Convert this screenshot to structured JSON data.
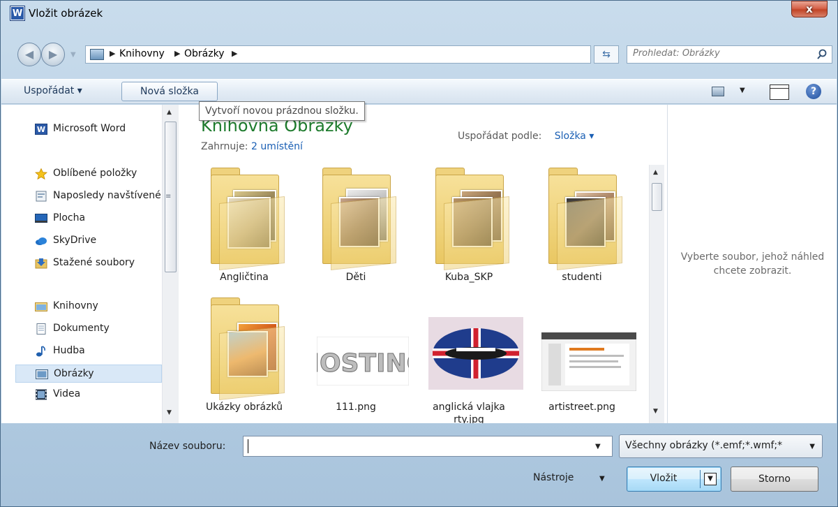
{
  "window": {
    "title": "Vložit obrázek",
    "app_icon_letter": "W",
    "close_label": "x"
  },
  "address": {
    "path": [
      "Knihovny",
      "Obrázky"
    ],
    "search_placeholder": "Prohledat: Obrázky"
  },
  "toolbar": {
    "organize_label": "Uspořádat ▾",
    "new_folder_label": "Nová složka",
    "tooltip": "Vytvoří novou prázdnou složku."
  },
  "nav_pane": {
    "items": [
      {
        "label": "Microsoft Word",
        "icon": "word-icon"
      },
      {
        "label": "Oblíbené položky",
        "icon": "star-icon"
      },
      {
        "label": "Naposledy navštívené",
        "icon": "recent-places-icon"
      },
      {
        "label": "Plocha",
        "icon": "desktop-icon"
      },
      {
        "label": "SkyDrive",
        "icon": "skydrive-icon"
      },
      {
        "label": "Stažené soubory",
        "icon": "downloads-icon"
      },
      {
        "label": "Knihovny",
        "icon": "libraries-icon"
      },
      {
        "label": "Dokumenty",
        "icon": "documents-icon"
      },
      {
        "label": "Hudba",
        "icon": "music-icon"
      },
      {
        "label": "Obrázky",
        "icon": "pictures-icon",
        "selected": true
      },
      {
        "label": "Videa",
        "icon": "videos-icon"
      }
    ]
  },
  "library": {
    "title": "Knihovna Obrázky",
    "includes_label": "Zahrnuje:",
    "includes_link": "2 umístění",
    "sort_label": "Uspořádat podle:",
    "sort_value": "Složka ▾"
  },
  "files": [
    {
      "name": "Angličtina",
      "type": "folder"
    },
    {
      "name": "Děti",
      "type": "folder"
    },
    {
      "name": "Kuba_SKP",
      "type": "folder"
    },
    {
      "name": "studenti",
      "type": "folder"
    },
    {
      "name": "Ukázky obrázků",
      "type": "folder"
    },
    {
      "name": "111.png",
      "type": "image",
      "thumb_text": "HOSTING"
    },
    {
      "name": "anglická vlajka rty.jpg",
      "type": "image"
    },
    {
      "name": "artistreet.png",
      "type": "image"
    }
  ],
  "preview": {
    "text": "Vyberte soubor, jehož náhled chcete zobrazit."
  },
  "bottom": {
    "filename_label": "Název souboru:",
    "filename_value": "",
    "filetype_value": "Všechny obrázky (*.emf;*.wmf;*",
    "tools_label": "Nástroje",
    "insert_label": "Vložit",
    "cancel_label": "Storno"
  },
  "colors": {
    "accent": "#1a5fb4",
    "library_title": "#1e7b2d",
    "selection": "#d9e8f7"
  }
}
